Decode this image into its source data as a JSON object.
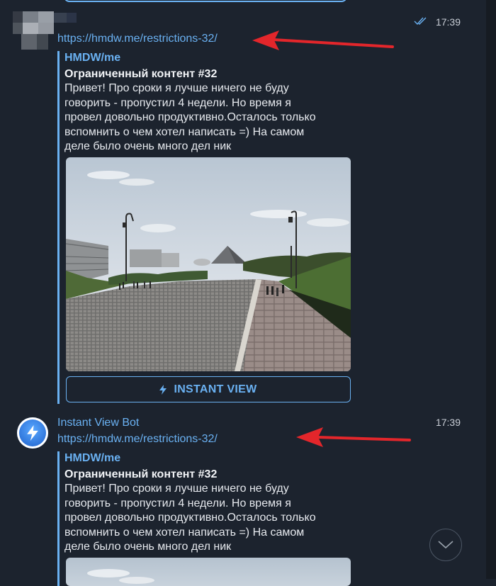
{
  "messages": [
    {
      "sender": "",
      "time": "17:39",
      "link_prefix": "https",
      "link_rest": "://hmdw.me/restrictions-32/",
      "preview": {
        "site_name": "HMDW/me",
        "title": "Ограниченный контент #32",
        "lines": [
          "Привет! Про сроки я лучше ничего не буду",
          "говорить - пропустил 4 недели. Но время я",
          "провел довольно продуктивно.Осталось только",
          "вспомнить о чем хотел написать =) На самом",
          "деле было очень много дел ник"
        ]
      },
      "instant_view_label": "INSTANT VIEW"
    },
    {
      "sender": "Instant View Bot",
      "time": "17:39",
      "link": "https://hmdw.me/restrictions-32/",
      "preview": {
        "site_name": "HMDW/me",
        "title": "Ограниченный контент #32",
        "lines": [
          "Привет! Про сроки я лучше ничего не буду",
          "говорить - пропустил 4 недели. Но время я",
          "провел довольно продуктивно.Осталось только",
          "вспомнить о чем хотел написать =) На самом",
          "деле было очень много дел ник"
        ]
      }
    }
  ],
  "icons": {
    "read_status": "double-check-icon",
    "bot_avatar": "lightning-icon",
    "instant_view": "lightning-icon",
    "scroll": "chevron-down-icon",
    "annotation": "red-arrow-icon"
  },
  "colors": {
    "background": "#1c232e",
    "accent": "#6ab1f2",
    "annotation_arrow": "#e3262b"
  }
}
